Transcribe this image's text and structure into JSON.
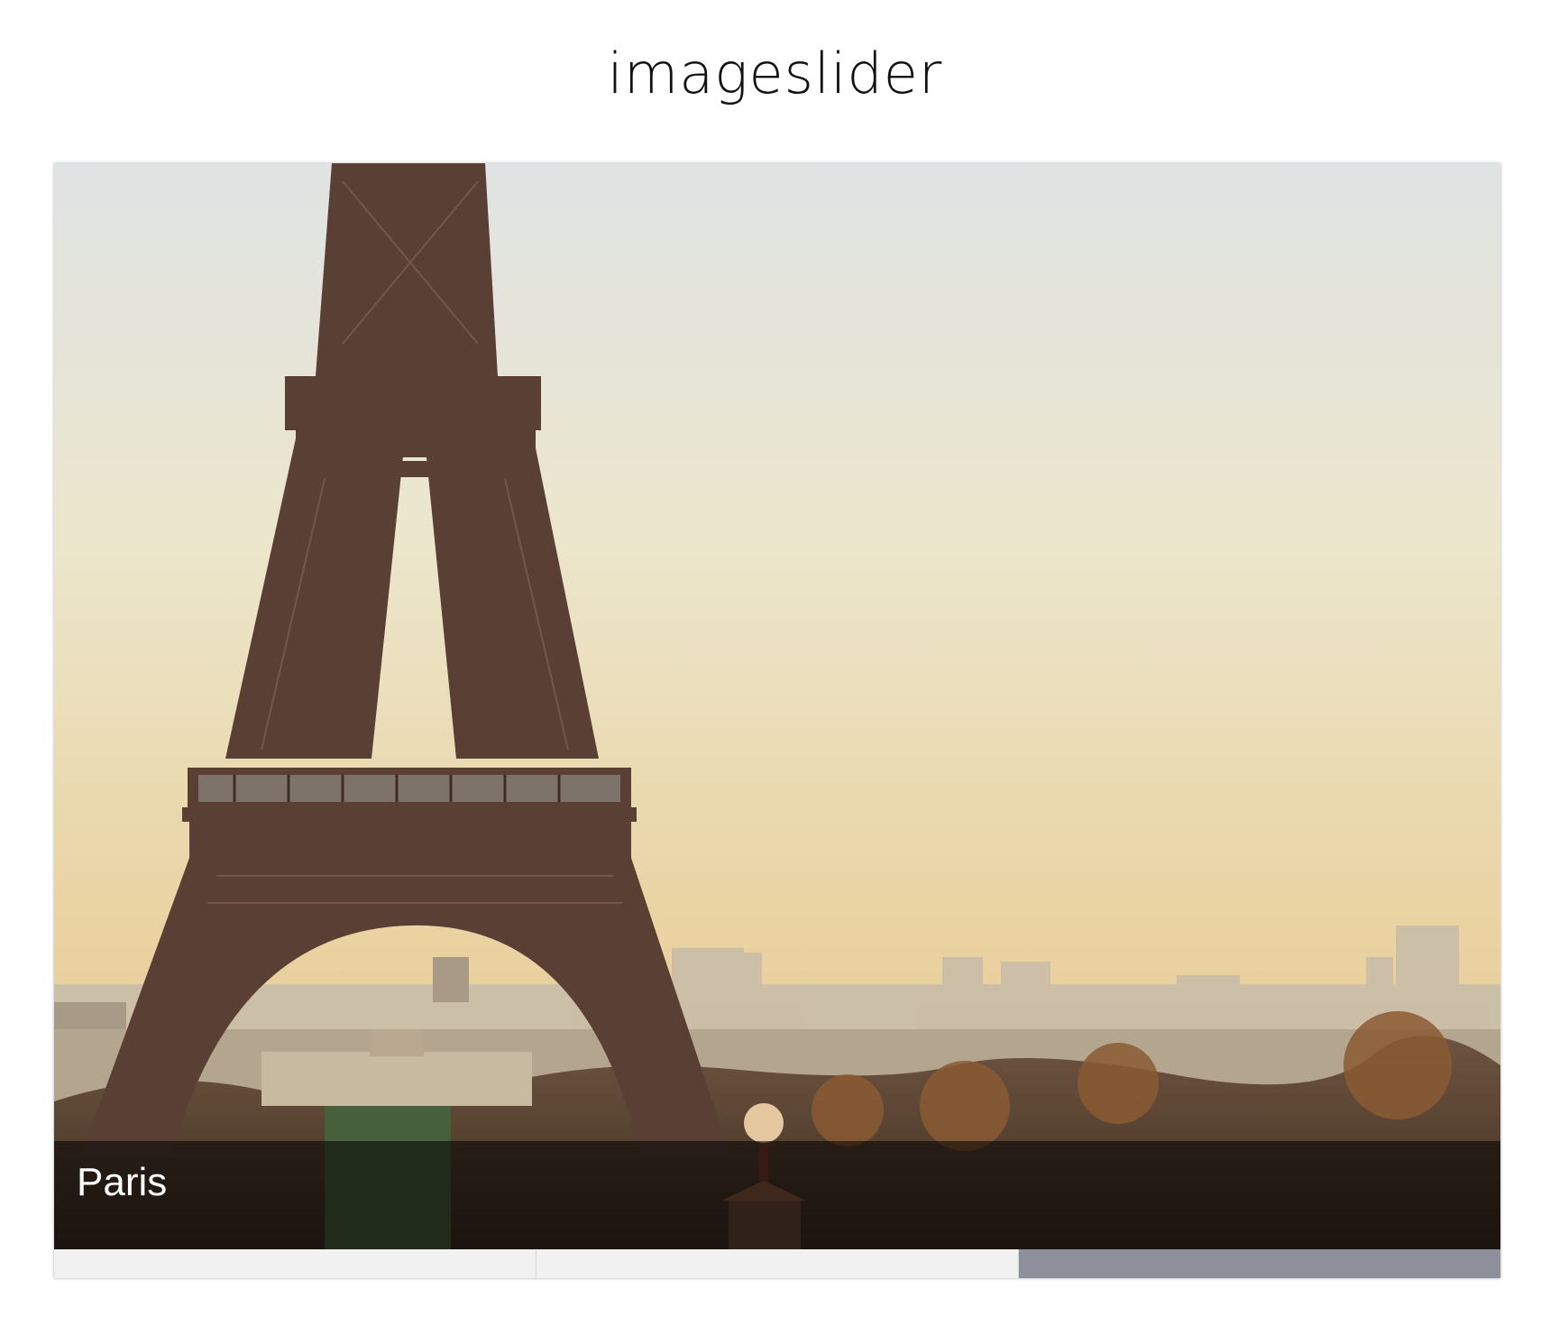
{
  "page": {
    "title": "imageslider"
  },
  "slider": {
    "caption": "Paris",
    "tabs": [
      {
        "active": false
      },
      {
        "active": false
      },
      {
        "active": true
      }
    ]
  },
  "colors": {
    "caption_overlay": "#000000",
    "pager_inactive": "#f1f1f1",
    "pager_active": "#8d909a"
  },
  "icons": [
    "eiffel-tower-photo"
  ]
}
